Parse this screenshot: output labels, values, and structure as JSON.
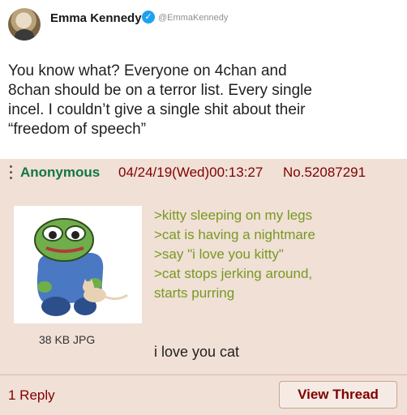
{
  "tweet": {
    "name": "Emma Kennedy",
    "handle": "@EmmaKennedy",
    "verified_icon": "✓",
    "lines": [
      "You know what? Everyone on 4chan and",
      "8chan should be on a terror list. Every single",
      "incel. I couldn’t give a single shit about their",
      "“freedom of speech”"
    ]
  },
  "post": {
    "poster_name": "Anonymous",
    "date": "04/24/19(Wed)00:13:27",
    "post_number": "No.52087291",
    "image_size": "38 KB JPG",
    "greentext": [
      ">kitty sleeping on my legs",
      ">cat is having a nightmare",
      ">say \"i love you kitty\"",
      ">cat stops jerking around,",
      "starts purring"
    ],
    "message": "i love you cat",
    "reply_count": "1 Reply",
    "view_thread_label": "View Thread"
  },
  "colors": {
    "post_bg": "#f0e0d6",
    "name_green": "#117743",
    "maroon": "#800000",
    "greentext": "#789922",
    "verified_blue": "#1da1f2"
  },
  "icons": [
    "avatar",
    "verified-badge-icon",
    "post-menu-dots-icon",
    "pepe-thumbnail"
  ]
}
